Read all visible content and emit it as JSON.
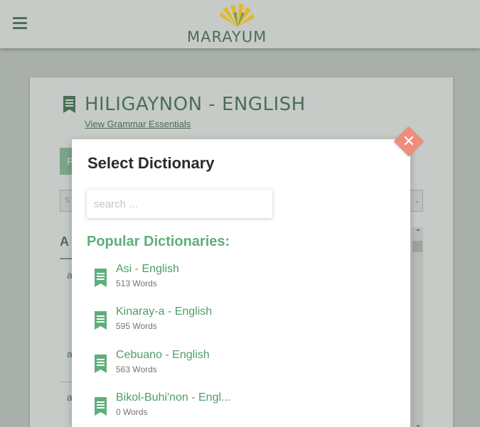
{
  "header": {
    "logo_text": "MARAYUM",
    "menu_icon": "hamburger-menu-icon",
    "brand_colors": {
      "green": "#4d6d58",
      "gold": "#e2b928"
    }
  },
  "page": {
    "title": "HILIGAYNON - ENGLISH",
    "grammar_link": "View Grammar Essentials",
    "button_partial": "F",
    "select_partial": "S",
    "letter_heading": "A",
    "row_letter": "a"
  },
  "modal": {
    "title": "Select Dictionary",
    "search_placeholder": "search ...",
    "popular_heading": "Popular Dictionaries:",
    "accent_color": "#5fae78",
    "close_color": "#ee8d7a",
    "dictionaries": [
      {
        "name": "Asi - English",
        "count": "513 Words"
      },
      {
        "name": "Kinaray-a - English",
        "count": "595 Words"
      },
      {
        "name": "Cebuano - English",
        "count": "563 Words"
      },
      {
        "name": "Bikol-Buhi'non - Engl...",
        "count": "0 Words"
      }
    ]
  }
}
